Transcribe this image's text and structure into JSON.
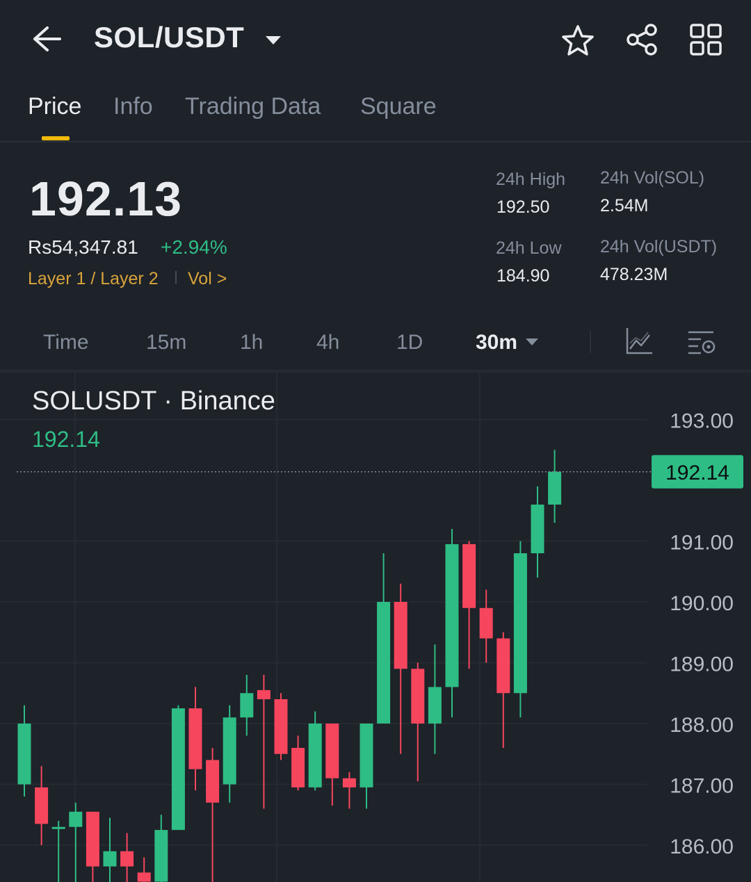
{
  "header": {
    "pair": "SOL/USDT",
    "icons": [
      "back-arrow-icon",
      "chevron-down-icon",
      "star-icon",
      "share-icon",
      "grid-icon"
    ]
  },
  "tabs": [
    {
      "label": "Price",
      "active": true
    },
    {
      "label": "Info",
      "active": false
    },
    {
      "label": "Trading Data",
      "active": false
    },
    {
      "label": "Square",
      "active": false
    }
  ],
  "price": {
    "last": "192.13",
    "fiat": "Rs54,347.81",
    "change": "+2.94%",
    "tag_category": "Layer 1 / Layer 2",
    "tag_vol": "Vol >"
  },
  "stats": {
    "high_label": "24h High",
    "high": "192.50",
    "low_label": "24h Low",
    "low": "184.90",
    "vol_base_label": "24h Vol(SOL)",
    "vol_base": "2.54M",
    "vol_quote_label": "24h Vol(USDT)",
    "vol_quote": "478.23M"
  },
  "intervals": {
    "items": [
      "Time",
      "15m",
      "1h",
      "4h",
      "1D"
    ],
    "selected": "30m"
  },
  "colors": {
    "up": "#2ebd85",
    "down": "#f6465d",
    "accent": "#f0b90b",
    "background": "#1e2229"
  },
  "chart_data": {
    "type": "candlestick",
    "symbol": "SOLUSDT · Binance",
    "last": "192.14",
    "y_ticks": [
      "193.00",
      "191.00",
      "190.00",
      "189.00",
      "188.00",
      "187.00",
      "186.00"
    ],
    "y_tick_values": [
      193,
      191,
      190,
      189,
      188,
      187,
      186
    ],
    "candles": [
      {
        "o": 187.0,
        "h": 188.3,
        "l": 186.8,
        "c": 188.0
      },
      {
        "o": 186.95,
        "h": 187.3,
        "l": 186.0,
        "c": 186.35
      },
      {
        "o": 186.3,
        "h": 186.4,
        "l": 185.25,
        "c": 186.3
      },
      {
        "o": 186.3,
        "h": 186.7,
        "l": 185.25,
        "c": 186.55
      },
      {
        "o": 186.55,
        "h": 186.55,
        "l": 185.35,
        "c": 185.65
      },
      {
        "o": 185.65,
        "h": 186.45,
        "l": 185.35,
        "c": 185.9
      },
      {
        "o": 185.9,
        "h": 186.2,
        "l": 185.2,
        "c": 185.65
      },
      {
        "o": 185.55,
        "h": 185.8,
        "l": 185.25,
        "c": 185.4
      },
      {
        "o": 185.4,
        "h": 186.5,
        "l": 185.2,
        "c": 186.25
      },
      {
        "o": 186.25,
        "h": 188.3,
        "l": 186.25,
        "c": 188.25
      },
      {
        "o": 188.25,
        "h": 188.6,
        "l": 186.9,
        "c": 187.25
      },
      {
        "o": 187.4,
        "h": 187.6,
        "l": 185.35,
        "c": 186.7
      },
      {
        "o": 187.0,
        "h": 188.3,
        "l": 186.7,
        "c": 188.1
      },
      {
        "o": 188.1,
        "h": 188.8,
        "l": 187.8,
        "c": 188.5
      },
      {
        "o": 188.55,
        "h": 188.8,
        "l": 186.6,
        "c": 188.4
      },
      {
        "o": 188.4,
        "h": 188.5,
        "l": 187.4,
        "c": 187.5
      },
      {
        "o": 187.6,
        "h": 187.8,
        "l": 186.9,
        "c": 186.95
      },
      {
        "o": 186.95,
        "h": 188.2,
        "l": 186.9,
        "c": 188.0
      },
      {
        "o": 188.0,
        "h": 188.0,
        "l": 186.65,
        "c": 187.1
      },
      {
        "o": 187.1,
        "h": 187.2,
        "l": 186.6,
        "c": 186.95
      },
      {
        "o": 186.95,
        "h": 188.0,
        "l": 186.6,
        "c": 188.0
      },
      {
        "o": 188.0,
        "h": 190.8,
        "l": 188.0,
        "c": 190.0
      },
      {
        "o": 190.0,
        "h": 190.3,
        "l": 187.5,
        "c": 188.9
      },
      {
        "o": 188.9,
        "h": 189.0,
        "l": 187.05,
        "c": 188.0
      },
      {
        "o": 188.0,
        "h": 189.3,
        "l": 187.5,
        "c": 188.6
      },
      {
        "o": 188.6,
        "h": 191.2,
        "l": 188.1,
        "c": 190.95
      },
      {
        "o": 190.95,
        "h": 191.0,
        "l": 188.9,
        "c": 189.9
      },
      {
        "o": 189.9,
        "h": 190.2,
        "l": 189.0,
        "c": 189.4
      },
      {
        "o": 189.4,
        "h": 189.5,
        "l": 187.6,
        "c": 188.5
      },
      {
        "o": 188.5,
        "h": 191.0,
        "l": 188.1,
        "c": 190.8
      },
      {
        "o": 190.8,
        "h": 191.9,
        "l": 190.4,
        "c": 191.6
      },
      {
        "o": 191.6,
        "h": 192.5,
        "l": 191.3,
        "c": 192.14
      }
    ]
  }
}
